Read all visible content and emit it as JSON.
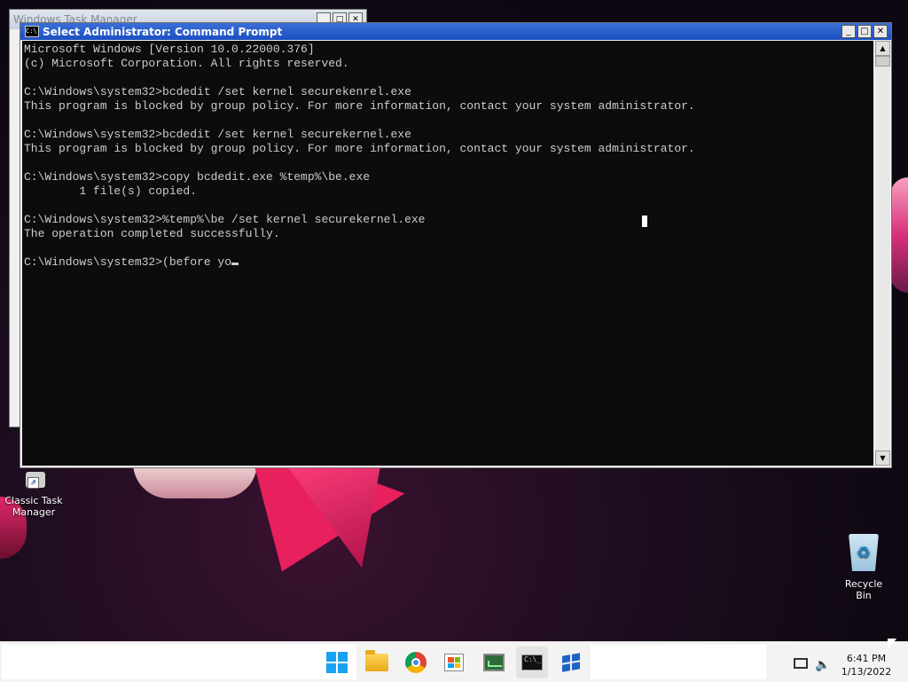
{
  "background_window": {
    "title": "Windows Task Manager"
  },
  "cmd_window": {
    "title": "Select Administrator: Command Prompt",
    "lines": [
      "Microsoft Windows [Version 10.0.22000.376]",
      "(c) Microsoft Corporation. All rights reserved.",
      "",
      "C:\\Windows\\system32>bcdedit /set kernel securekenrel.exe",
      "This program is blocked by group policy. For more information, contact your system administrator.",
      "",
      "C:\\Windows\\system32>bcdedit /set kernel securekernel.exe",
      "This program is blocked by group policy. For more information, contact your system administrator.",
      "",
      "C:\\Windows\\system32>copy bcdedit.exe %temp%\\be.exe",
      "        1 file(s) copied.",
      "",
      "C:\\Windows\\system32>%temp%\\be /set kernel securekernel.exe",
      "The operation completed successfully.",
      ""
    ],
    "current_input": "C:\\Windows\\system32>(before yo"
  },
  "desktop_icons": {
    "classic_task_manager": "Classic Task\nManager",
    "recycle_bin": "Recycle Bin"
  },
  "taskbar": {
    "apps": [
      "start",
      "file-explorer",
      "chrome",
      "microsoft-store",
      "task-manager",
      "command-prompt",
      "windows-app"
    ],
    "time": "6:41 PM",
    "date": "1/13/2022"
  }
}
